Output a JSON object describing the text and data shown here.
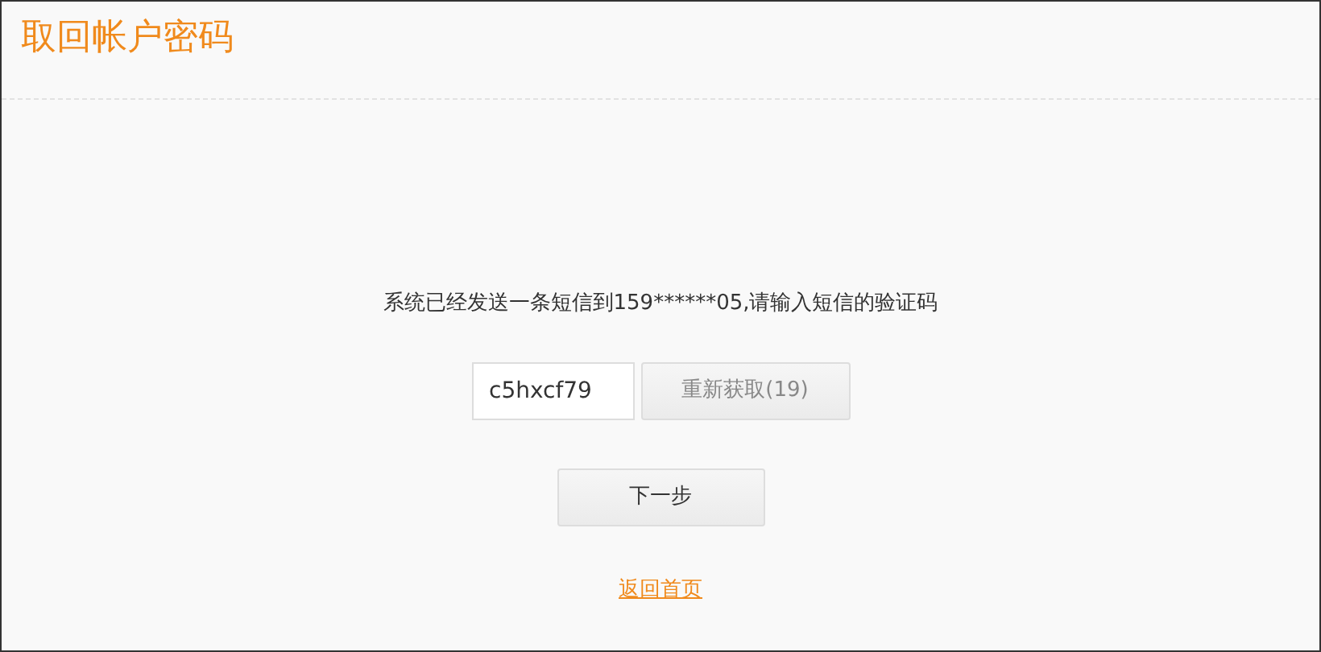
{
  "page": {
    "title": "取回帐户密码"
  },
  "message": "系统已经发送一条短信到159******05,请输入短信的验证码",
  "code_field": {
    "value": "c5hxcf79"
  },
  "resend_button": {
    "label": "重新获取(19)",
    "disabled": true
  },
  "next_button": {
    "label": "下一步"
  },
  "home_link": {
    "label": "返回首页"
  }
}
